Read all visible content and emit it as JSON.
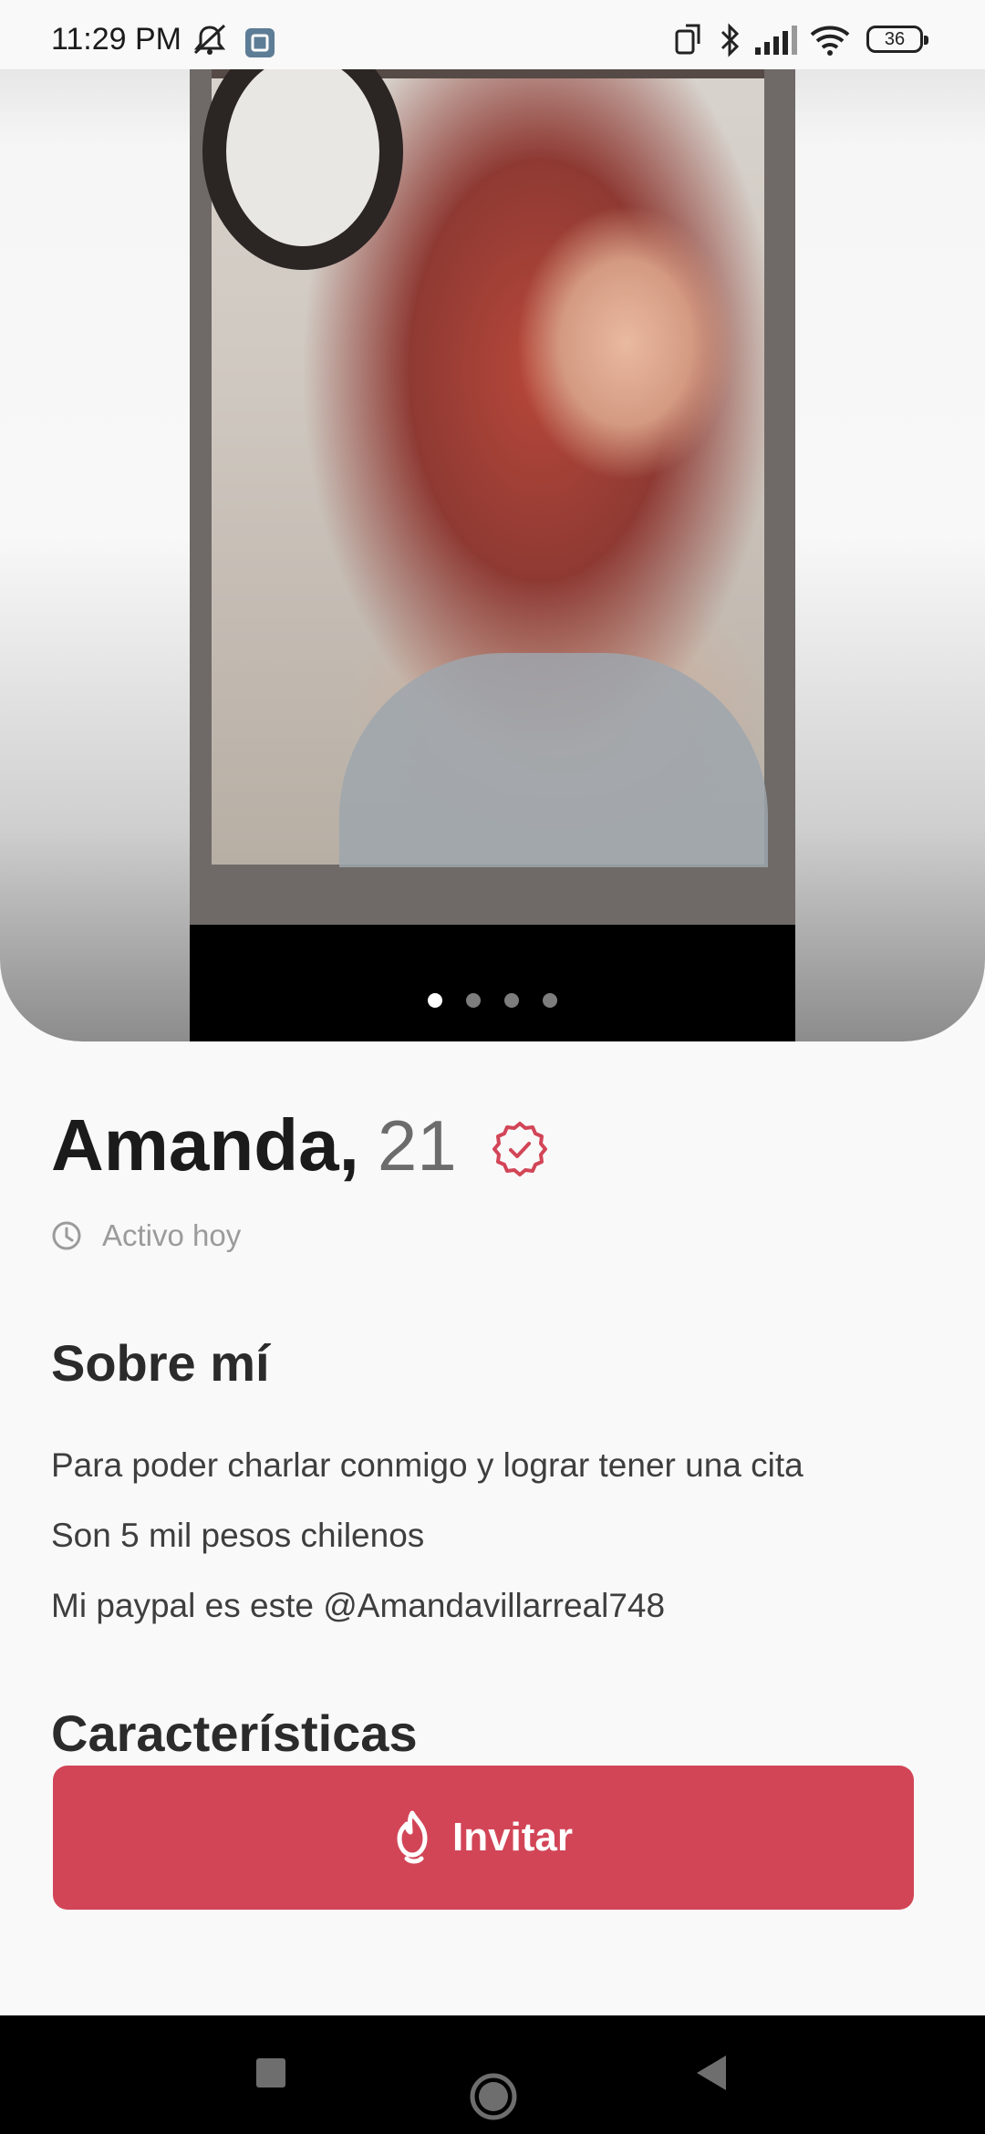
{
  "status_bar": {
    "time": "11:29 PM",
    "battery": "36",
    "icons": [
      "mute-icon",
      "gallery-notification-icon",
      "rotate-icon",
      "bluetooth-icon",
      "signal-icon",
      "wifi-icon",
      "battery-icon"
    ]
  },
  "photo": {
    "page_count": 4,
    "active_index": 0
  },
  "profile": {
    "name": "Amanda,",
    "age": "21",
    "verified_icon": "verified-badge-icon",
    "activity": "Activo hoy"
  },
  "about": {
    "title": "Sobre mí",
    "lines": [
      "Para poder charlar conmigo y lograr tener una cita",
      "Son 5 mil pesos chilenos",
      "Mi paypal es este @Amandavillarreal748"
    ]
  },
  "characteristics": {
    "title": "Características"
  },
  "cta": {
    "label": "Invitar",
    "icon": "flame-icon"
  },
  "colors": {
    "accent": "#d24557",
    "text": "#1b1b1b",
    "muted": "#9b9b9b"
  },
  "nav": [
    "recents-button",
    "home-button",
    "back-button"
  ]
}
